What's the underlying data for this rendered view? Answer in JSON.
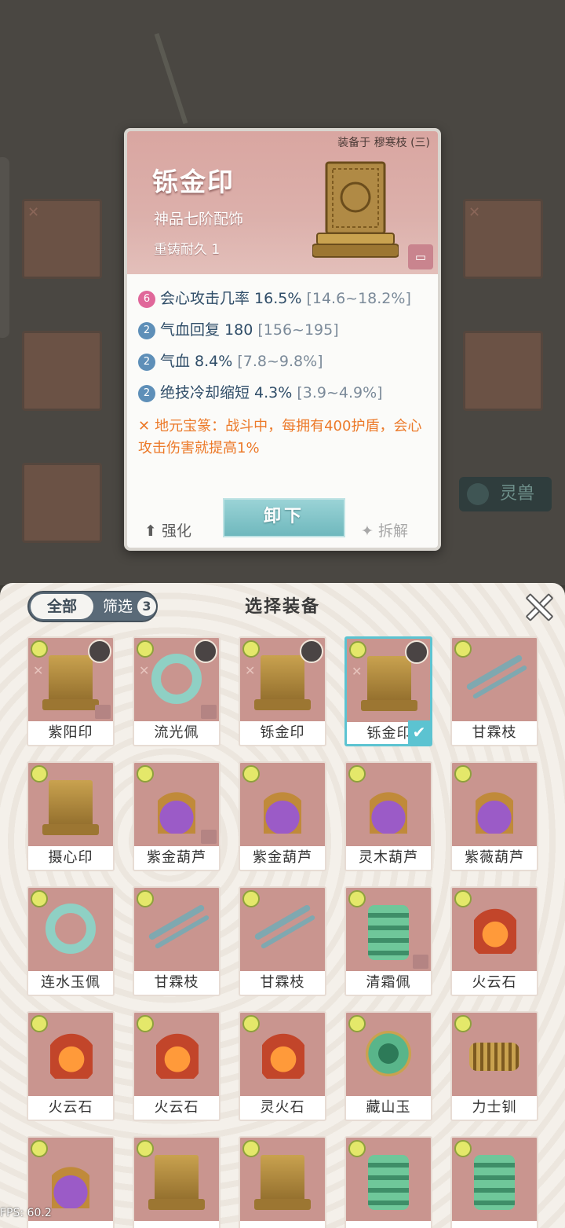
{
  "detail": {
    "equipped_by": "装备于 穆寒枝 (三)",
    "name": "铄金印",
    "grade": "神品七阶配饰",
    "reforge": "重铸耐久 1",
    "stats": [
      {
        "badge": "6",
        "badge_color": "#e0679a",
        "text": "会心攻击几率 16.5%",
        "range": "[14.6~18.2%]"
      },
      {
        "badge": "2",
        "badge_color": "#5e8fb8",
        "text": "气血回复 180",
        "range": "[156~195]"
      },
      {
        "badge": "2",
        "badge_color": "#5e8fb8",
        "text": "气血 8.4%",
        "range": "[7.8~9.8%]"
      },
      {
        "badge": "2",
        "badge_color": "#5e8fb8",
        "text": "绝技冷却缩短 4.3%",
        "range": "[3.9~4.9%]"
      }
    ],
    "skill": "地元宝篆：战斗中，每拥有400护盾，会心攻击伤害就提高1%",
    "unequip_label": "卸下",
    "enhance_label": "强化",
    "dismantle_label": "拆解"
  },
  "background": {
    "spirit_beast_label": "灵兽"
  },
  "panel": {
    "tab_all": "全部",
    "tab_filter": "筛选",
    "filter_count": "3",
    "title": "选择装备"
  },
  "items": [
    {
      "name": "紫阳印",
      "art": "seal",
      "reforge": true,
      "owner": true,
      "lock": true,
      "selected": false
    },
    {
      "name": "流光佩",
      "art": "ring",
      "reforge": true,
      "owner": true,
      "lock": true,
      "selected": false
    },
    {
      "name": "铄金印",
      "art": "seal",
      "reforge": true,
      "owner": true,
      "lock": false,
      "selected": false
    },
    {
      "name": "铄金印",
      "art": "seal",
      "reforge": true,
      "owner": true,
      "lock": false,
      "selected": true
    },
    {
      "name": "甘霖枝",
      "art": "branch",
      "reforge": false,
      "owner": false,
      "lock": false,
      "selected": false
    },
    {
      "name": "摄心印",
      "art": "seal",
      "reforge": false,
      "owner": false,
      "lock": false,
      "selected": false
    },
    {
      "name": "紫金葫芦",
      "art": "gourd",
      "reforge": false,
      "owner": false,
      "lock": true,
      "selected": false
    },
    {
      "name": "紫金葫芦",
      "art": "gourd",
      "reforge": false,
      "owner": false,
      "lock": false,
      "selected": false
    },
    {
      "name": "灵木葫芦",
      "art": "gourd",
      "reforge": false,
      "owner": false,
      "lock": false,
      "selected": false
    },
    {
      "name": "紫薇葫芦",
      "art": "gourd",
      "reforge": false,
      "owner": false,
      "lock": false,
      "selected": false
    },
    {
      "name": "连水玉佩",
      "art": "ring",
      "reforge": false,
      "owner": false,
      "lock": false,
      "selected": false
    },
    {
      "name": "甘霖枝",
      "art": "branch",
      "reforge": false,
      "owner": false,
      "lock": false,
      "selected": false
    },
    {
      "name": "甘霖枝",
      "art": "branch",
      "reforge": false,
      "owner": false,
      "lock": false,
      "selected": false
    },
    {
      "name": "清霜佩",
      "art": "twin",
      "reforge": false,
      "owner": false,
      "lock": true,
      "selected": false
    },
    {
      "name": "火云石",
      "art": "rock",
      "reforge": false,
      "owner": false,
      "lock": false,
      "selected": false
    },
    {
      "name": "火云石",
      "art": "rock",
      "reforge": false,
      "owner": false,
      "lock": false,
      "selected": false
    },
    {
      "name": "火云石",
      "art": "rock",
      "reforge": false,
      "owner": false,
      "lock": false,
      "selected": false
    },
    {
      "name": "灵火石",
      "art": "rock",
      "reforge": false,
      "owner": false,
      "lock": false,
      "selected": false
    },
    {
      "name": "藏山玉",
      "art": "jade",
      "reforge": false,
      "owner": false,
      "lock": false,
      "selected": false
    },
    {
      "name": "力士钏",
      "art": "spring",
      "reforge": false,
      "owner": false,
      "lock": false,
      "selected": false
    },
    {
      "name": "",
      "art": "gourd",
      "reforge": false,
      "owner": false,
      "lock": false,
      "selected": false
    },
    {
      "name": "",
      "art": "seal",
      "reforge": false,
      "owner": false,
      "lock": false,
      "selected": false
    },
    {
      "name": "",
      "art": "seal",
      "reforge": false,
      "owner": false,
      "lock": false,
      "selected": false
    },
    {
      "name": "",
      "art": "twin",
      "reforge": false,
      "owner": false,
      "lock": false,
      "selected": false
    },
    {
      "name": "",
      "art": "twin",
      "reforge": false,
      "owner": false,
      "lock": false,
      "selected": false
    }
  ],
  "fps": "FPS: 60.2"
}
